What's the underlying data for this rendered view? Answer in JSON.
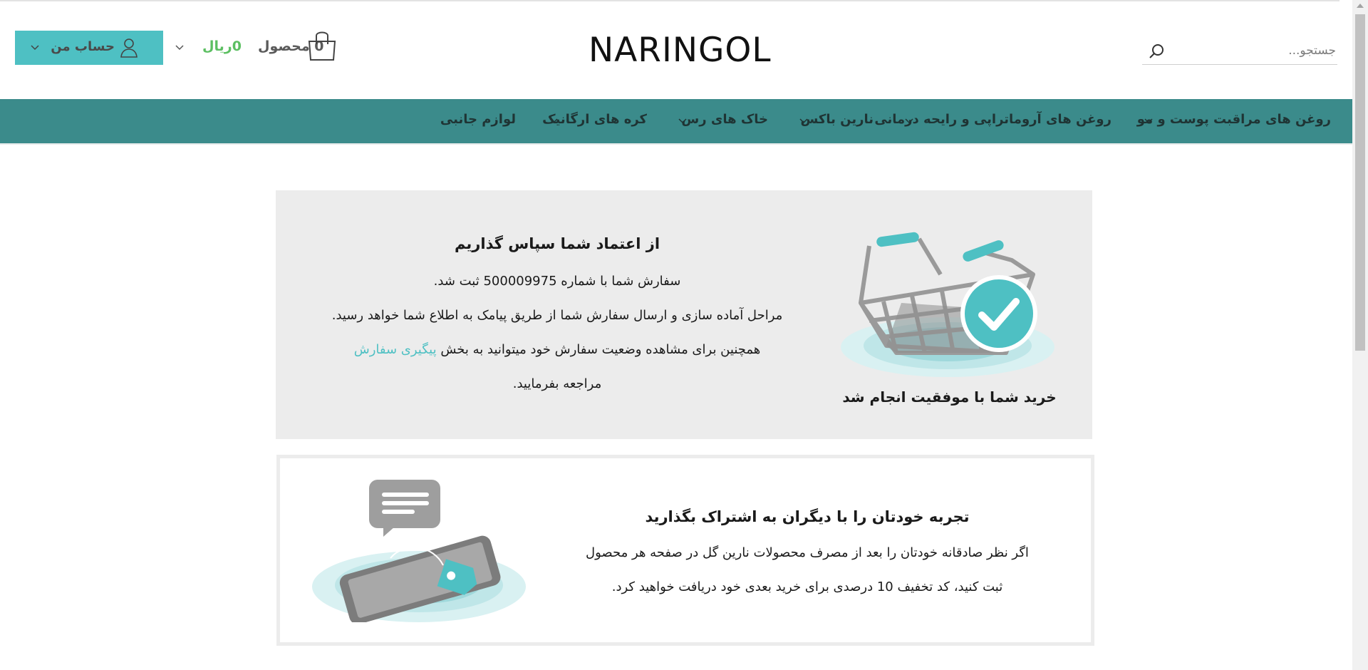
{
  "header": {
    "logo": "NARINGOL",
    "search_placeholder": "جستجو...",
    "account_label": "حساب من",
    "cart_count": "0 محصول",
    "cart_price": "0ریال"
  },
  "nav": {
    "items": [
      "روغن های مراقبت پوست و مو",
      "روغن های آروماتراپی و رایحه درمانی",
      "نارین باکس",
      "خاک های رس",
      "کره های ارگانیک",
      "لوازم جانبی"
    ]
  },
  "success": {
    "title": "از اعتماد شما سپاس گذاریم",
    "line1": "سفارش شما با شماره 500009975 ثبت شد.",
    "line2": "مراحل آماده سازی و ارسال سفارش شما از طریق پیامک به اطلاع شما خواهد رسید.",
    "line3_prefix": "همچنین برای مشاهده وضعیت سفارش خود میتوانید به بخش ",
    "line3_link": "پیگیری سفارش",
    "line4": "مراجعه بفرمایید.",
    "image_caption": "خرید شما با موفقیت انجام شد"
  },
  "review": {
    "title": "تجربه خودتان را با دیگران به اشتراک بگذارید",
    "line1": "اگر نظر صادقانه خودتان را بعد از مصرف محصولات نارین گل در صفحه هر محصول",
    "line2": "ثبت کنید، کد تخفیف 10 درصدی برای خرید بعدی خود دریافت خواهید کرد."
  },
  "colors": {
    "accent": "#4ec0c3",
    "nav_bg": "#3b8b8b",
    "price_green": "#5cbf62",
    "box_bg": "#ececec"
  }
}
